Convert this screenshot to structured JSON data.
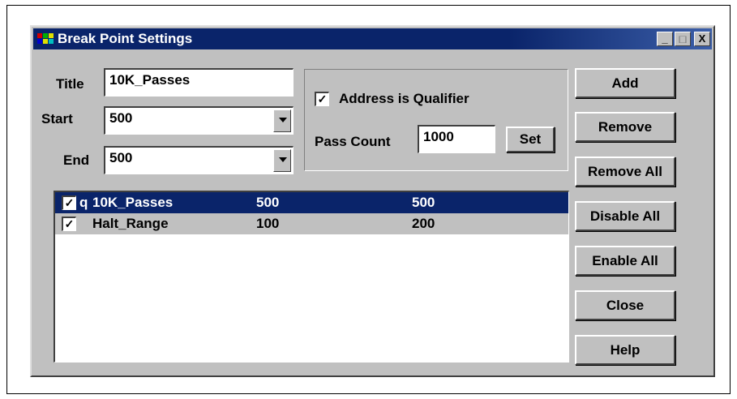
{
  "dialog": {
    "title": "Break Point Settings",
    "minimize_glyph": "_",
    "maximize_glyph": "□",
    "close_glyph": "X"
  },
  "fields": {
    "title_label": "Title",
    "title_value": "10K_Passes",
    "start_label": "Start",
    "start_value": "500",
    "end_label": "End",
    "end_value": "500"
  },
  "qualifier": {
    "address_checkbox_mark": "✓",
    "address_label": "Address is Qualifier",
    "pass_count_label": "Pass Count",
    "pass_count_value": "1000",
    "set_label": "Set"
  },
  "buttons": {
    "add": "Add",
    "remove": "Remove",
    "remove_all": "Remove All",
    "disable_all": "Disable All",
    "enable_all": "Enable All",
    "close": "Close",
    "help": "Help"
  },
  "breakpoints": [
    {
      "checked_mark": "✓",
      "flag": "q",
      "name": "10K_Passes",
      "start": "500",
      "end": "500",
      "selected": true
    },
    {
      "checked_mark": "✓",
      "flag": "",
      "name": "Halt_Range",
      "start": "100",
      "end": "200",
      "selected": false
    }
  ],
  "colors": {
    "titlebar": "#0a246a",
    "face": "#c0c0c0",
    "selection": "#0a246a"
  }
}
